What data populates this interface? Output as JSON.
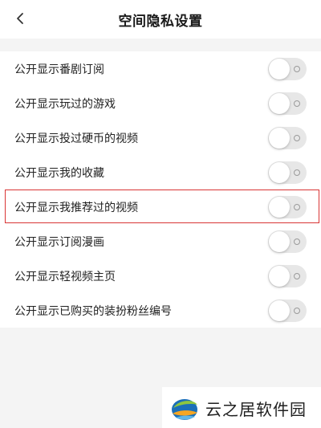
{
  "header": {
    "title": "空间隐私设置",
    "back_icon": "chevron-left-icon"
  },
  "settings": {
    "items": [
      {
        "label": "公开显示番剧订阅",
        "enabled": false
      },
      {
        "label": "公开显示玩过的游戏",
        "enabled": false
      },
      {
        "label": "公开显示投过硬币的视频",
        "enabled": false
      },
      {
        "label": "公开显示我的收藏",
        "enabled": false
      },
      {
        "label": "公开显示我推荐过的视频",
        "enabled": false,
        "highlighted": true
      },
      {
        "label": "公开显示订阅漫画",
        "enabled": false
      },
      {
        "label": "公开显示轻视频主页",
        "enabled": false
      },
      {
        "label": "公开显示已购买的装扮粉丝编号",
        "enabled": false
      }
    ]
  },
  "watermark": {
    "text": "云之居软件园",
    "icon": "site-logo-icon"
  },
  "colors": {
    "background": "#f4f4f4",
    "toggle_off": "#e7e7e7",
    "highlight_border": "#d93535"
  }
}
